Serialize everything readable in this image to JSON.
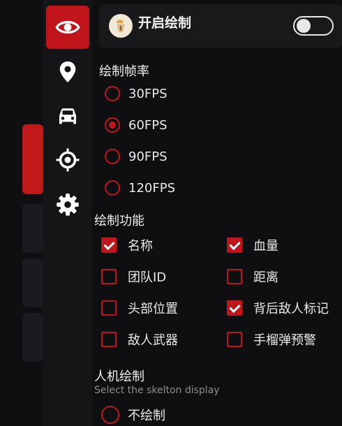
{
  "header": {
    "title": "开启绘制",
    "toggle_on": false
  },
  "sidebar": {
    "items": [
      {
        "icon": "eye-icon",
        "active": true
      },
      {
        "icon": "location-pin-icon",
        "active": false
      },
      {
        "icon": "car-icon",
        "active": false
      },
      {
        "icon": "crosshair-icon",
        "active": false
      },
      {
        "icon": "gear-icon",
        "active": false
      }
    ]
  },
  "frame_rate": {
    "title": "绘制帧率",
    "options": [
      {
        "label": "30FPS",
        "selected": false
      },
      {
        "label": "60FPS",
        "selected": true
      },
      {
        "label": "90FPS",
        "selected": false
      },
      {
        "label": "120FPS",
        "selected": false
      }
    ]
  },
  "features": {
    "title": "绘制功能",
    "items": [
      {
        "label": "名称",
        "checked": true
      },
      {
        "label": "血量",
        "checked": true
      },
      {
        "label": "团队ID",
        "checked": false
      },
      {
        "label": "距离",
        "checked": false
      },
      {
        "label": "头部位置",
        "checked": false
      },
      {
        "label": "背后敌人标记",
        "checked": true
      },
      {
        "label": "敌人武器",
        "checked": false
      },
      {
        "label": "手榴弹预警",
        "checked": false
      }
    ]
  },
  "bot_draw": {
    "title": "人机绘制",
    "subtitle": "Select the skelton display",
    "options": [
      {
        "label": "不绘制",
        "selected": false
      }
    ]
  },
  "colors": {
    "accent": "#c0161b",
    "background": "#0f0f11",
    "panel": "#151518"
  }
}
